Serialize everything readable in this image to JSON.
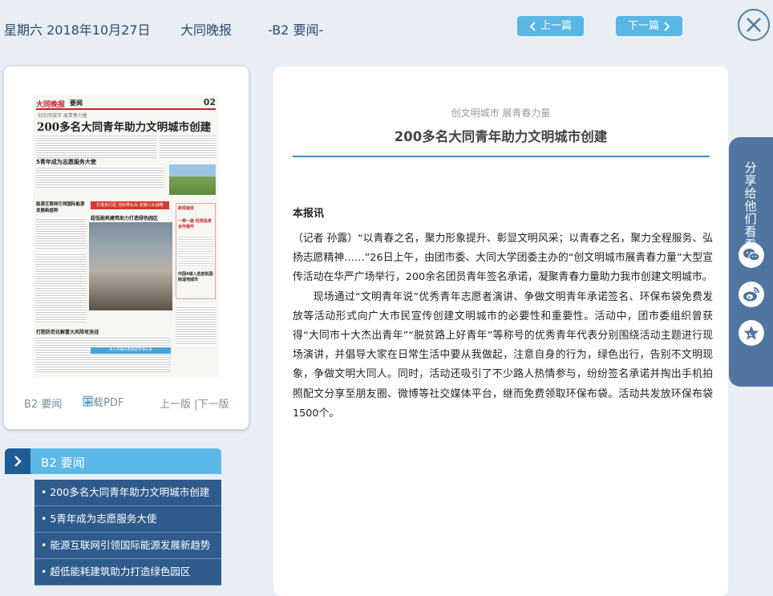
{
  "header": {
    "date": "星期六 2018年10月27日",
    "paper": "大同晚报",
    "page": "-B2 要闻-",
    "prev_label": "上一篇",
    "next_label": "下一篇"
  },
  "page_card": {
    "page_label": "B2 要闻",
    "pdf_label": "下载PDF",
    "prev_next_label": "上一版 |下一版",
    "thumbnail": {
      "masthead": "大同晚报",
      "section": "要闻",
      "page_no": "02",
      "kicker": "创文明城市 展青春力量",
      "headline": "200多名大同青年助力文明城市创建",
      "sub_headline": "5青年成为志愿服务大使",
      "red_banner": "打造先行区 当好排头兵 实施三大战略",
      "story2": "超低能耗建筑助力打造绿色园区",
      "story3": "能源互联网引领国际能源发展新趋势",
      "story4": "打胜防范化解重大风险攻坚战",
      "sidebar_title": "新闻速览",
      "sidebar_story": "一带一路 经贸投资合作展开",
      "sidebar_story2": "中国4城入选首批国际湿地城市",
      "bottom_banner": "深入开展扫黑除恶专项斗争"
    }
  },
  "section_nav": {
    "title": "B2 要闻",
    "items": [
      "200多名大同青年助力文明城市创建",
      "5青年成为志愿服务大使",
      "能源互联网引领国际能源发展新趋势",
      "超低能耗建筑助力打造绿色园区"
    ]
  },
  "article": {
    "kicker": "创文明城市 展青春力量",
    "headline": "200多名大同青年助力文明城市创建",
    "lead": "本报讯",
    "paragraphs": [
      "（记者 孙露）“以青春之名，聚力形象提升、彰显文明风采；以青春之名，聚力全程服务、弘扬志愿精神……”26日上午，由团市委、大同大学团委主办的“创文明城市展青春力量”大型宣传活动在华严广场举行，200余名团员青年签名承诺，凝聚青春力量助力我市创建文明城市。",
      "现场通过“文明青年说”优秀青年志愿者演讲、争做文明青年承诺签名、环保布袋免费发放等活动形式向广大市民宣传创建文明城市的必要性和重要性。活动中，团市委组织曾获得“大同市十大杰出青年”“脱贫路上好青年”等称号的优秀青年代表分别围绕活动主题进行现场演讲，并倡导大家在日常生活中要从我做起，注意自身的行为，绿色出行，告别不文明现象，争做文明大同人。同时，活动还吸引了不少路人热情参与，纷纷签名承诺并掏出手机拍照配文分享至朋友圈、微博等社交媒体平台，继而免费领取环保布袋。活动共发放环保布袋1500个。"
    ]
  },
  "share": {
    "label": "分享给他们看看",
    "icons": [
      "wechat-icon",
      "weibo-icon",
      "star-icon"
    ]
  },
  "colors": {
    "accent": "#5ab6e4",
    "nav_dark": "#2f5b8c",
    "rule": "#3a8fc9"
  }
}
